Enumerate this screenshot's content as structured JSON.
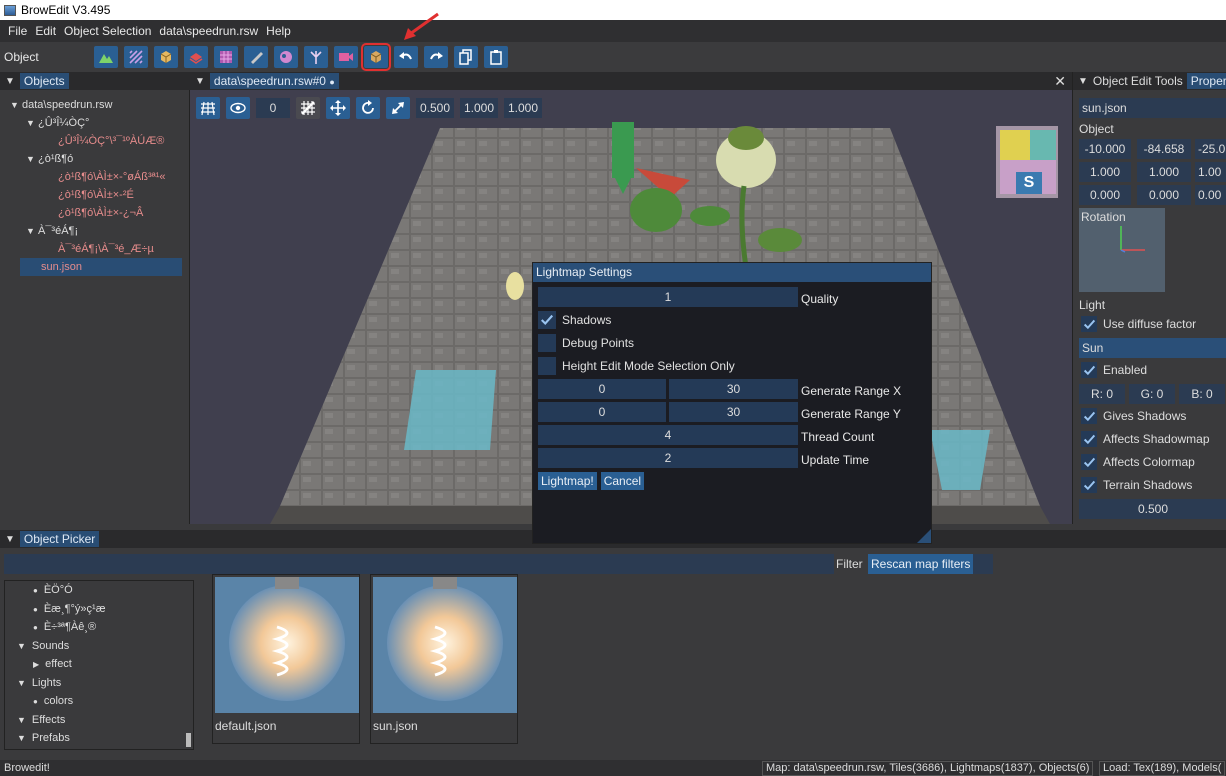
{
  "window": {
    "title": "BrowEdit V3.495"
  },
  "menu": [
    "File",
    "Edit",
    "Object Selection",
    "data\\speedrun.rsw",
    "Help"
  ],
  "toolbar": {
    "label": "Object",
    "buttons": [
      "heightmap-mode-icon",
      "texture-mode-icon",
      "object-mode-icon",
      "wall-mode-icon",
      "gat-mode-icon",
      "draw-icon",
      "sprite-icon",
      "effect-icon",
      "camera-icon",
      "lightmap-icon",
      "undo-icon",
      "redo-icon",
      "copy-icon",
      "paste-icon"
    ],
    "selected_index": 9
  },
  "objects_panel": {
    "tab": "Objects",
    "tree": [
      {
        "label": "data\\speedrun.rsw",
        "level": 0,
        "expanded": true,
        "garbled": false,
        "selected": false
      },
      {
        "label": "¿Û³Î¼ÒÇ°",
        "level": 1,
        "expanded": true,
        "garbled": false,
        "selected": false
      },
      {
        "label": "¿Û³Î¼ÒÇ°\\³¯¹ºÀÚÆ®",
        "level": 2,
        "expanded": null,
        "garbled": true,
        "selected": false
      },
      {
        "label": "¿ò¹ß¶ó",
        "level": 1,
        "expanded": true,
        "garbled": false,
        "selected": false
      },
      {
        "label": "¿ò¹ß¶ó\\ÀÌ±×-°øÁß³ª¹«",
        "level": 2,
        "expanded": null,
        "garbled": true,
        "selected": false
      },
      {
        "label": "¿ò¹ß¶ó\\ÀÌ±×-²É",
        "level": 2,
        "expanded": null,
        "garbled": true,
        "selected": false
      },
      {
        "label": "¿ò¹ß¶ó\\ÀÌ±×-¿¬Â",
        "level": 2,
        "expanded": null,
        "garbled": true,
        "selected": false
      },
      {
        "label": "À¯³éÁ¶¡",
        "level": 1,
        "expanded": true,
        "garbled": false,
        "selected": false
      },
      {
        "label": "À¯³éÁ¶¡\\À¯³é_Æ÷µ",
        "level": 2,
        "expanded": null,
        "garbled": true,
        "selected": false
      },
      {
        "label": "sun.json",
        "level": 2,
        "expanded": null,
        "garbled": true,
        "selected": true
      }
    ]
  },
  "viewport": {
    "tab": "data\\speedrun.rsw#0",
    "tab_dot": "●",
    "close": "✕",
    "grid_value": "0",
    "fields": [
      "0.500",
      "1.000",
      "1.000"
    ],
    "gizmo_label": "S"
  },
  "lightmap_dialog": {
    "title": "Lightmap Settings",
    "quality_value": "1",
    "quality_label": "Quality",
    "shadows_label": "Shadows",
    "shadows_checked": true,
    "debug_points_label": "Debug Points",
    "debug_points_checked": false,
    "height_edit_label": "Height Edit Mode Selection Only",
    "height_edit_checked": false,
    "range_x": [
      "0",
      "30"
    ],
    "range_x_label": "Generate Range X",
    "range_y": [
      "0",
      "30"
    ],
    "range_y_label": "Generate Range Y",
    "thread_count_value": "4",
    "thread_count_label": "Thread Count",
    "update_time_value": "2",
    "update_time_label": "Update Time",
    "lightmap_button": "Lightmap!",
    "cancel_button": "Cancel"
  },
  "right_panel": {
    "tab_active": "Object Edit Tools",
    "tab_other": "Proper",
    "name_value": "sun.json",
    "object_label": "Object",
    "position": [
      "-10.000",
      "-84.658",
      "-25.0"
    ],
    "scale": [
      "1.000",
      "1.000",
      "1.00"
    ],
    "rotation": [
      "0.000",
      "0.000",
      "0.00"
    ],
    "rotation_label": "Rotation",
    "light_label": "Light",
    "use_diffuse_label": "Use diffuse factor",
    "sun_label": "Sun",
    "enabled_label": "Enabled",
    "rgb": [
      "R: 0",
      "G: 0",
      "B: 0"
    ],
    "gives_shadows_label": "Gives Shadows",
    "affects_shadowmap_label": "Affects Shadowmap",
    "affects_colormap_label": "Affects Colormap",
    "terrain_shadows_label": "Terrain Shadows",
    "intensity_value": "0.500"
  },
  "picker": {
    "tab": "Object Picker",
    "filter_label": "Filter",
    "rescan_button": "Rescan map filters",
    "tree": [
      {
        "label": "ÈÖ°Ó",
        "marker": "●",
        "indent": 2
      },
      {
        "label": "Èæ¸¶°ý»ç¹æ",
        "marker": "●",
        "indent": 2
      },
      {
        "label": "È÷³ª¶Àê¸®",
        "marker": "●",
        "indent": 2
      },
      {
        "label": "Sounds",
        "marker": "▼",
        "indent": 1
      },
      {
        "label": "effect",
        "marker": "▶",
        "indent": 2
      },
      {
        "label": "Lights",
        "marker": "▼",
        "indent": 1
      },
      {
        "label": "colors",
        "marker": "●",
        "indent": 2
      },
      {
        "label": "Effects",
        "marker": "▼",
        "indent": 1
      },
      {
        "label": "Prefabs",
        "marker": "▼",
        "indent": 1
      }
    ],
    "thumbnails": [
      "default.json",
      "sun.json"
    ]
  },
  "status": {
    "left": "Browedit!",
    "map_info": "Map: data\\speedrun.rsw, Tiles(3686), Lightmaps(1837), Objects(6)",
    "load_info": "Load: Tex(189), Models("
  },
  "colors": {
    "accent": "#2a5f93",
    "highlight_red": "#e03030",
    "garbled_text": "#e68c8c"
  }
}
